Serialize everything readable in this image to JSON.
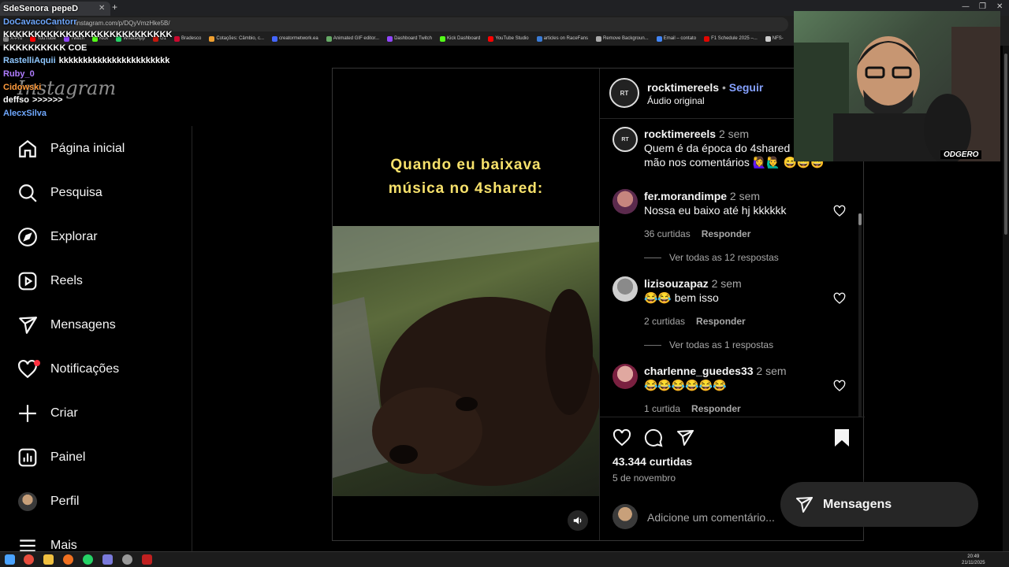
{
  "browser": {
    "url": "instagram.com/p/DQyVmzHke5B/",
    "bookmarks": [
      "X-Pro",
      "YouTube",
      "Twitch",
      "Kick",
      "WhatsApp",
      "G1",
      "Bradesco",
      "Cotações: Câmbio, c...",
      "creatormetwork.ea",
      "Animated GIF editor...",
      "Dashboard Twitch",
      "Kick Dashboard",
      "YouTube Studio",
      "articles on RaceFans",
      "Remove Backgroun...",
      "Email – contato",
      "F1 Schedule 2025 –...",
      "NFS-"
    ]
  },
  "chat": [
    {
      "user": "SdeSenora",
      "msg": "pepeD",
      "color": "#ffffff"
    },
    {
      "user": "DoCavacoCantorr",
      "msg": "",
      "color": "#6fa8ff"
    },
    {
      "user": "",
      "msg": "KKKKKKKKKKKKKKKKKKKKKKKKKKK",
      "color": "#ffffff"
    },
    {
      "user": "",
      "msg": "KKKKKKKKKK COE",
      "color": "#ffffff"
    },
    {
      "user": "RastelliAquii",
      "msg": "kkkkkkkkkkkkkkkkkkkkkkk",
      "color": "#8fc8ff"
    },
    {
      "user": "Ruby_0",
      "msg": "",
      "color": "#b07cff"
    },
    {
      "user": "Cidowski",
      "msg": "",
      "color": "#ff9b3d"
    },
    {
      "user": "deffso",
      "msg": ">>>>>>",
      "color": "#ffffff"
    },
    {
      "user": "AlecxSilva",
      "msg": "",
      "color": "#6fa8ff"
    }
  ],
  "instagram_logo": "Instagram",
  "nav": [
    {
      "label": "Página inicial",
      "icon": "home-icon"
    },
    {
      "label": "Pesquisa",
      "icon": "search-icon"
    },
    {
      "label": "Explorar",
      "icon": "compass-icon"
    },
    {
      "label": "Reels",
      "icon": "reels-icon"
    },
    {
      "label": "Mensagens",
      "icon": "send-icon"
    },
    {
      "label": "Notificações",
      "icon": "heart-icon"
    },
    {
      "label": "Criar",
      "icon": "plus-icon"
    },
    {
      "label": "Painel",
      "icon": "dashboard-icon"
    },
    {
      "label": "Perfil",
      "icon": "profile-avatar"
    },
    {
      "label": "Mais",
      "icon": "menu-icon"
    }
  ],
  "post": {
    "caption_line1": "Quando eu baixava",
    "caption_line2": "música no 4shared:",
    "author": "rocktimereels",
    "follow": "Seguir",
    "dot": "•",
    "audio": "Áudio original",
    "desc_user": "rocktimereels",
    "desc_time": "2 sem",
    "desc_text": "Quem é da época do 4shared levanta a mão nos comentários 🙋‍♀️🙋‍♂️ 😅😅😅",
    "likes": "43.344 curtidas",
    "date": "5 de novembro",
    "add_comment": "Adicione um comentário..."
  },
  "comments": [
    {
      "user": "fer.morandimpe",
      "time": "2 sem",
      "text": "Nossa eu baixo até hj kkkkkk",
      "likes": "36 curtidas",
      "reply": "Responder",
      "replies": "Ver todas as 12 respostas"
    },
    {
      "user": "lizisouzapaz",
      "time": "2 sem",
      "text": "😂😂 bem isso",
      "likes": "2 curtidas",
      "reply": "Responder",
      "replies": "Ver todas as 1 respostas"
    },
    {
      "user": "charlenne_guedes33",
      "time": "2 sem",
      "text": "😂😂😂😂😂😂",
      "likes": "1 curtida",
      "reply": "Responder",
      "replies": ""
    }
  ],
  "messages_button": "Mensagens",
  "webcam_tag": "ODGERO",
  "clock": {
    "time": "20:49",
    "date": "21/11/2025"
  }
}
